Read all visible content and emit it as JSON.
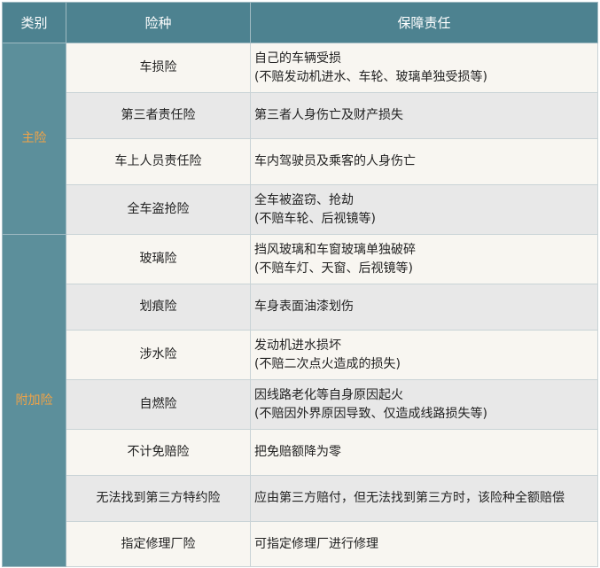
{
  "headers": {
    "category": "类别",
    "type": "险种",
    "responsibility": "保障责任"
  },
  "groups": [
    {
      "category": "主险",
      "rows": [
        {
          "type": "车损险",
          "resp": [
            "自己的车辆受损",
            "(不赔发动机进水、车轮、玻璃单独受损等)"
          ]
        },
        {
          "type": "第三者责任险",
          "resp": [
            "第三者人身伤亡及财产损失"
          ]
        },
        {
          "type": "车上人员责任险",
          "resp": [
            "车内驾驶员及乘客的人身伤亡"
          ]
        },
        {
          "type": "全车盗抢险",
          "resp": [
            "全车被盗窃、抢劫",
            "(不赔车轮、后视镜等)"
          ]
        }
      ]
    },
    {
      "category": "附加险",
      "rows": [
        {
          "type": "玻璃险",
          "resp": [
            "挡风玻璃和车窗玻璃单独破碎",
            "(不赔车灯、天窗、后视镜等)"
          ]
        },
        {
          "type": "划痕险",
          "resp": [
            "车身表面油漆划伤"
          ]
        },
        {
          "type": "涉水险",
          "resp": [
            "发动机进水损坏",
            "(不赔二次点火造成的损失)"
          ]
        },
        {
          "type": "自燃险",
          "resp": [
            "因线路老化等自身原因起火",
            "(不赔因外界原因导致、仅造成线路损失等)"
          ]
        },
        {
          "type": "不计免赔险",
          "resp": [
            "把免赔额降为零"
          ]
        },
        {
          "type": "无法找到第三方特约险",
          "resp": [
            "应由第三方赔付，但无法找到第三方时，该险种全额赔偿"
          ]
        },
        {
          "type": "指定修理厂险",
          "resp": [
            "可指定修理厂进行修理"
          ]
        }
      ]
    }
  ],
  "colors": {
    "header_bg": "#4d8290",
    "category_bg": "#5c8f9b",
    "category_text": "#f0a347",
    "row_light": "#f8f6f1",
    "row_gray": "#e8e8e8"
  }
}
